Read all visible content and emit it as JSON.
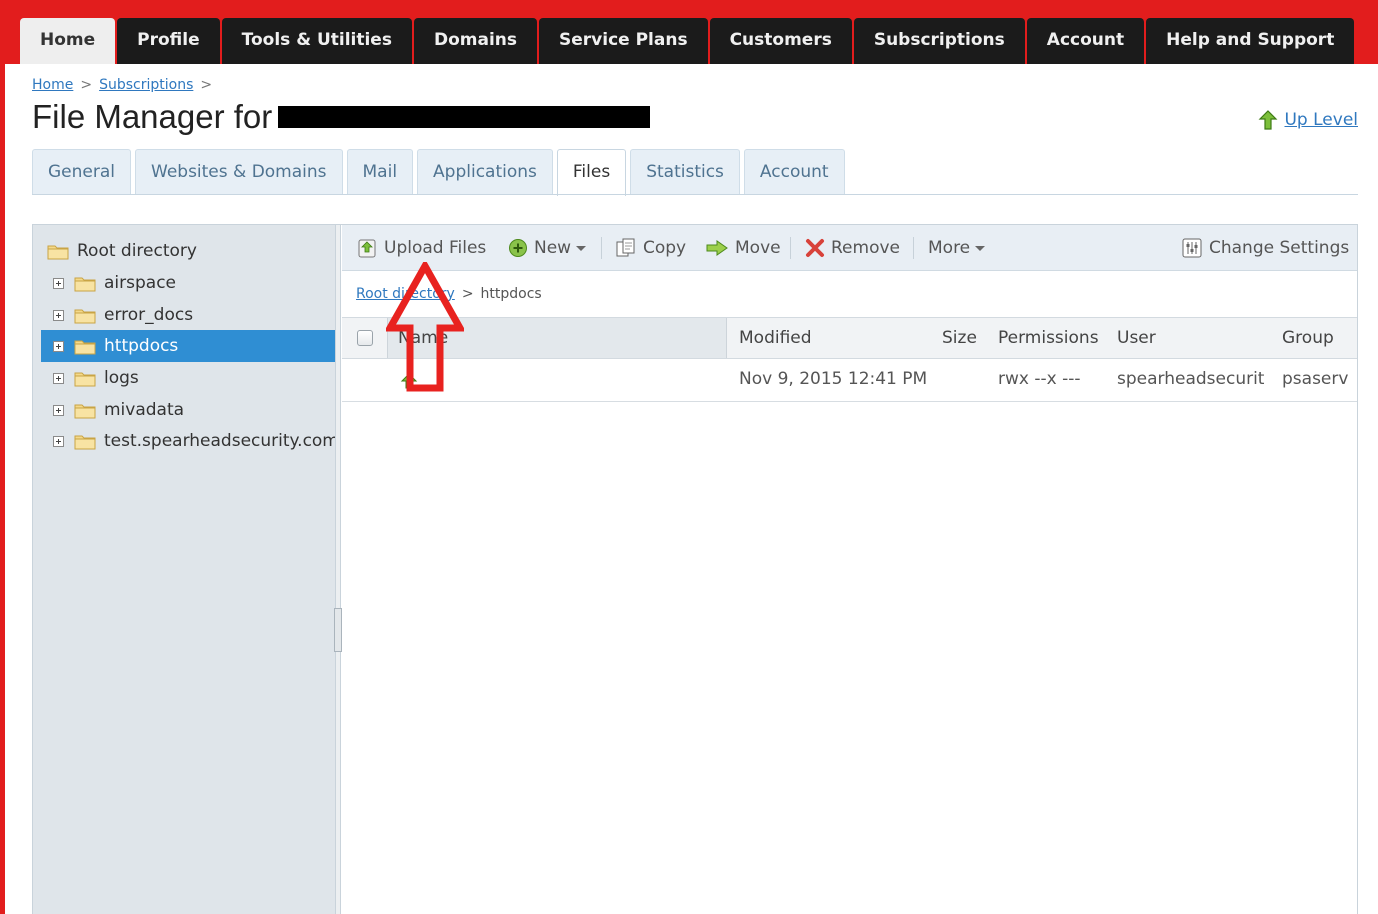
{
  "nav": {
    "items": [
      {
        "label": "Home",
        "active": true
      },
      {
        "label": "Profile"
      },
      {
        "label": "Tools & Utilities"
      },
      {
        "label": "Domains"
      },
      {
        "label": "Service Plans"
      },
      {
        "label": "Customers"
      },
      {
        "label": "Subscriptions"
      },
      {
        "label": "Account"
      },
      {
        "label": "Help and Support"
      }
    ]
  },
  "breadcrumb": {
    "home": "Home",
    "subscriptions": "Subscriptions",
    "sep": ">"
  },
  "page": {
    "title": "File Manager for",
    "up_level": "Up Level"
  },
  "tabs": [
    {
      "label": "General"
    },
    {
      "label": "Websites & Domains"
    },
    {
      "label": "Mail"
    },
    {
      "label": "Applications"
    },
    {
      "label": "Files",
      "active": true
    },
    {
      "label": "Statistics"
    },
    {
      "label": "Account"
    }
  ],
  "tree": {
    "root": "Root directory",
    "items": [
      "airspace",
      "error_docs",
      "httpdocs",
      "logs",
      "mivadata",
      "test.spearheadsecurity.com"
    ],
    "selected": "httpdocs"
  },
  "toolbar": {
    "upload": "Upload Files",
    "new": "New",
    "copy": "Copy",
    "move": "Move",
    "remove": "Remove",
    "more": "More",
    "settings": "Change Settings"
  },
  "path": {
    "root": "Root directory",
    "sep": ">",
    "current": "httpdocs"
  },
  "table": {
    "columns": {
      "name": "Name",
      "modified": "Modified",
      "size": "Size",
      "permissions": "Permissions",
      "user": "User",
      "group": "Group"
    },
    "rows": [
      {
        "modified": "Nov 9, 2015 12:41 PM",
        "size": "",
        "permissions": "rwx --x ---",
        "user": "spearheadsecurit",
        "group": "psaserv"
      }
    ]
  },
  "colors": {
    "brand_red": "#e21d1d",
    "nav_dark": "#1b1b1b",
    "selection_blue": "#2f8ed3",
    "link_blue": "#2f78bf",
    "annotation_red": "#e8221f"
  }
}
